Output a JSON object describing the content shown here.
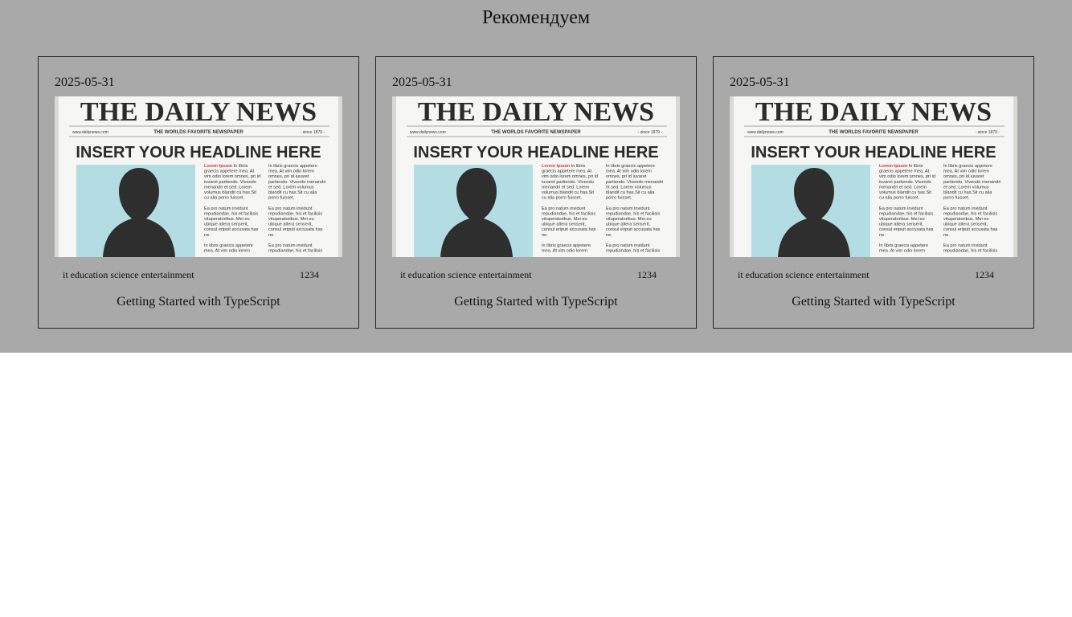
{
  "section": {
    "title": "Рекомендуем"
  },
  "cards": [
    {
      "date": "2025-05-31",
      "image": {
        "masthead": "THE DAILY NEWS",
        "site": "www.dailynews.com",
        "tagline": "THE WORLDS FAVORITE NEWSPAPER",
        "since": "- since 1879 -",
        "headline": "INSERT YOUR HEADLINE HERE",
        "col1": [
          "Lorem Ipsum In libris",
          "graecis appetere mea. At",
          "vim odio lorem omnes, pri id",
          "iuvaret partiendo. Vivendo",
          "menandri et sed. Lorem",
          "volumus blandit cu has.Sit",
          "cu alia porro fuisset.",
          "",
          "Ea pro natum invidunt",
          "repudiandae, his et facilisis",
          "vituperatoribus. Mei eu",
          "ubique altera senserit,",
          "consul eripuit accusata has",
          "ne.",
          "",
          "In libris graecis appetere",
          "mea. At vim odio lorem"
        ],
        "col2": [
          "In libris graecis appetere",
          "mea. At vim odio lorem",
          "omnes, pri id iuvaret",
          "partiendo. Vivendo menandri",
          "et sed. Lorem volumus",
          "blandit cu has.Sit cu alia",
          "porro fuisset.",
          "",
          "Ea pro natum invidunt",
          "repudiandae, his et facilisis",
          "vituperatoribus. Mei eu",
          "ubique altera senserit,",
          "consul eripuit accusata has",
          "ne.",
          "",
          "Ea pro natum invidunt",
          "repudiandae, his et facilisis"
        ]
      },
      "tags": "it education science entertainment",
      "views": "1234",
      "title": "Getting Started with TypeScript"
    },
    {
      "date": "2025-05-31",
      "image": {
        "masthead": "THE DAILY NEWS",
        "site": "www.dailynews.com",
        "tagline": "THE WORLDS FAVORITE NEWSPAPER",
        "since": "- since 1879 -",
        "headline": "INSERT YOUR HEADLINE HERE",
        "col1": [
          "Lorem Ipsum In libris",
          "graecis appetere mea. At",
          "vim odio lorem omnes, pri id",
          "iuvaret partiendo. Vivendo",
          "menandri et sed. Lorem",
          "volumus blandit cu has.Sit",
          "cu alia porro fuisset.",
          "",
          "Ea pro natum invidunt",
          "repudiandae, his et facilisis",
          "vituperatoribus. Mei eu",
          "ubique altera senserit,",
          "consul eripuit accusata has",
          "ne.",
          "",
          "In libris graecis appetere",
          "mea. At vim odio lorem"
        ],
        "col2": [
          "In libris graecis appetere",
          "mea. At vim odio lorem",
          "omnes, pri id iuvaret",
          "partiendo. Vivendo menandri",
          "et sed. Lorem volumus",
          "blandit cu has.Sit cu alia",
          "porro fuisset.",
          "",
          "Ea pro natum invidunt",
          "repudiandae, his et facilisis",
          "vituperatoribus. Mei eu",
          "ubique altera senserit,",
          "consul eripuit accusata has",
          "ne.",
          "",
          "Ea pro natum invidunt",
          "repudiandae, his et facilisis"
        ]
      },
      "tags": "it education science entertainment",
      "views": "1234",
      "title": "Getting Started with TypeScript"
    },
    {
      "date": "2025-05-31",
      "image": {
        "masthead": "THE DAILY NEWS",
        "site": "www.dailynews.com",
        "tagline": "THE WORLDS FAVORITE NEWSPAPER",
        "since": "- since 1879 -",
        "headline": "INSERT YOUR HEADLINE HERE",
        "col1": [
          "Lorem Ipsum In libris",
          "graecis appetere mea. At",
          "vim odio lorem omnes, pri id",
          "iuvaret partiendo. Vivendo",
          "menandri et sed. Lorem",
          "volumus blandit cu has.Sit",
          "cu alia porro fuisset.",
          "",
          "Ea pro natum invidunt",
          "repudiandae, his et facilisis",
          "vituperatoribus. Mei eu",
          "ubique altera senserit,",
          "consul eripuit accusata has",
          "ne.",
          "",
          "In libris graecis appetere",
          "mea. At vim odio lorem"
        ],
        "col2": [
          "In libris graecis appetere",
          "mea. At vim odio lorem",
          "omnes, pri id iuvaret",
          "partiendo. Vivendo menandri",
          "et sed. Lorem volumus",
          "blandit cu has.Sit cu alia",
          "porro fuisset.",
          "",
          "Ea pro natum invidunt",
          "repudiandae, his et facilisis",
          "vituperatoribus. Mei eu",
          "ubique altera senserit,",
          "consul eripuit accusata has",
          "ne.",
          "",
          "Ea pro natum invidunt",
          "repudiandae, his et facilisis"
        ]
      },
      "tags": "it education science entertainment",
      "views": "1234",
      "title": "Getting Started with TypeScript"
    }
  ],
  "colors": {
    "section_background": "#a9a9a9",
    "page_background": "#ffffff",
    "card_border": "#222222",
    "photo_background": "#b3dde3",
    "silhouette": "#2e2e2e",
    "lorem_red": "#d6333a"
  }
}
